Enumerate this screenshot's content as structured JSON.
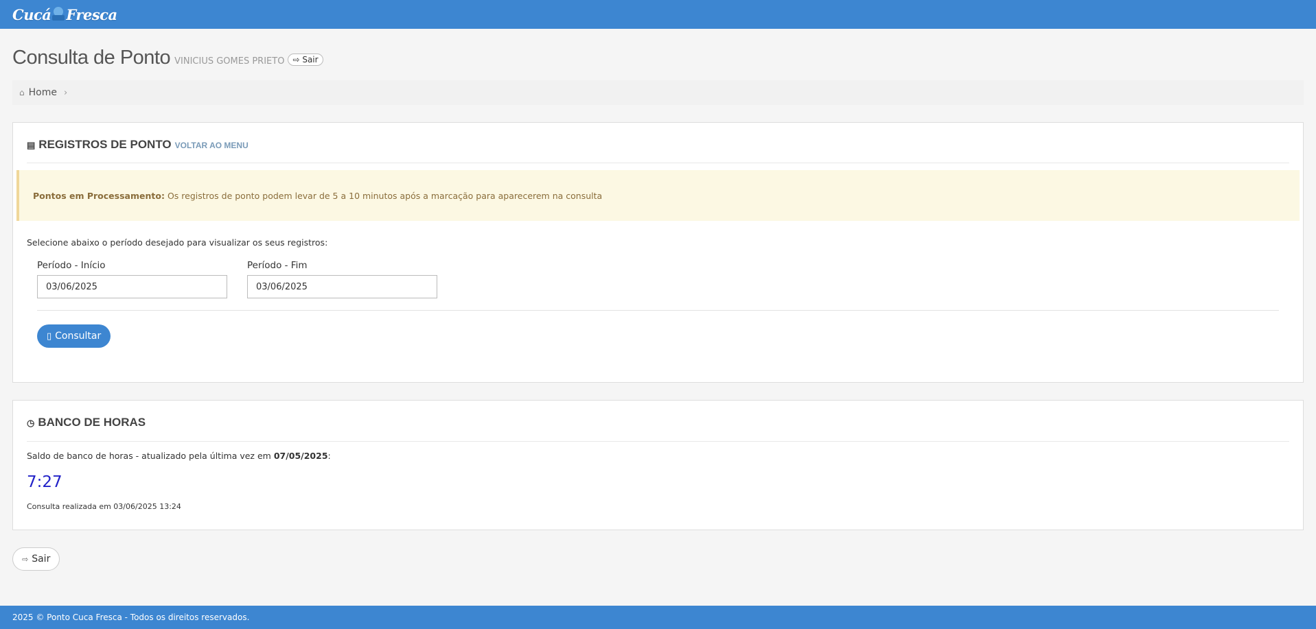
{
  "header": {
    "logo_left": "Cucá",
    "logo_right": "Fresca"
  },
  "page": {
    "title": "Consulta de Ponto",
    "user_name": "VINICIUS GOMES PRIETO",
    "logout_small_label": "Sair"
  },
  "breadcrumb": {
    "home_label": "Home",
    "separator": "›"
  },
  "registros": {
    "title": "REGISTROS DE PONTO",
    "back_link": "VOLTAR AO MENU",
    "alert_strong": "Pontos em Processamento:",
    "alert_text": "Os registros de ponto podem levar de 5 a 10 minutos após a marcação para aparecerem na consulta",
    "help_text": "Selecione abaixo o período desejado para visualizar os seus registros:",
    "start_label": "Período - Início",
    "start_value": "03/06/2025",
    "end_label": "Período - Fim",
    "end_value": "03/06/2025",
    "submit_label": "Consultar"
  },
  "banco": {
    "title": "BANCO DE HORAS",
    "saldo_prefix": "Saldo de banco de horas - atualizado pela última vez em ",
    "saldo_date": "07/05/2025",
    "saldo_suffix": ":",
    "saldo_value": "7:27",
    "consulta_info": "Consulta realizada em 03/06/2025 13:24"
  },
  "actions": {
    "logout_label": "Sair"
  },
  "footer": {
    "text": "2025 © Ponto Cuca Fresca - Todos os direitos reservados."
  },
  "colors": {
    "brand_blue": "#3d86d1",
    "alert_bg": "#fcf8e3",
    "alert_text": "#8a6d3b",
    "saldo_value": "#2222c8"
  },
  "icons": {
    "home": "home-icon",
    "book": "book-icon",
    "clock": "clock-icon",
    "file": "file-icon",
    "sign_out": "sign-out-icon"
  }
}
